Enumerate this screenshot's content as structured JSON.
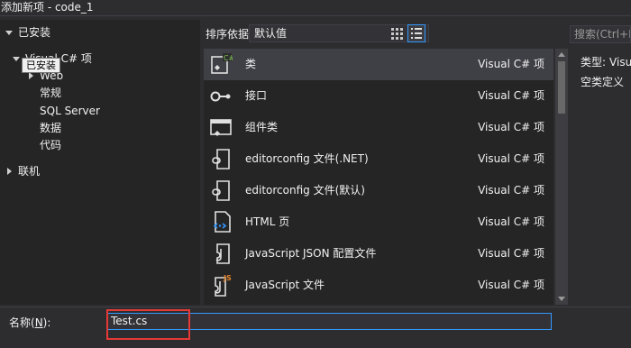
{
  "window": {
    "title": "添加新项 - code_1"
  },
  "tree": {
    "installed": "已安装",
    "csharp": "Visual C# 项",
    "children": [
      "Web",
      "常规",
      "SQL Server",
      "数据",
      "代码"
    ],
    "online": "联机",
    "tooltip": "已安装"
  },
  "sort": {
    "label": "排序依据:",
    "value": "默认值"
  },
  "search": {
    "placeholder": "搜索(Ctrl+E)"
  },
  "templates": [
    {
      "name": "类",
      "lang": "Visual C# 项",
      "icon": "csharp-class-icon"
    },
    {
      "name": "接口",
      "lang": "Visual C# 项",
      "icon": "interface-icon"
    },
    {
      "name": "组件类",
      "lang": "Visual C# 项",
      "icon": "component-class-icon"
    },
    {
      "name": "editorconfig 文件(.NET)",
      "lang": "Visual C# 项",
      "icon": "editorconfig-icon"
    },
    {
      "name": "editorconfig 文件(默认)",
      "lang": "Visual C# 项",
      "icon": "editorconfig-icon"
    },
    {
      "name": "HTML 页",
      "lang": "Visual C# 项",
      "icon": "html-page-icon"
    },
    {
      "name": "JavaScript JSON 配置文件",
      "lang": "Visual C# 项",
      "icon": "json-config-icon"
    },
    {
      "name": "JavaScript 文件",
      "lang": "Visual C# 项",
      "icon": "javascript-file-icon"
    }
  ],
  "details": {
    "type_label": "类型:",
    "type_value": "Visual C# 项",
    "description": "空类定义"
  },
  "name_field": {
    "label_prefix": "名称(",
    "label_key": "N",
    "label_suffix": "):",
    "value": "Test.cs"
  },
  "colors": {
    "accent": "#3399ff",
    "highlight": "#e53935",
    "background": "#2d2d30"
  }
}
